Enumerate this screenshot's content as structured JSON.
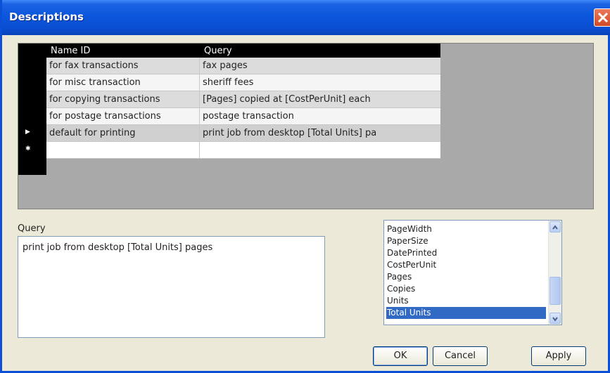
{
  "window": {
    "title": "Descriptions"
  },
  "grid": {
    "columns": [
      "Name ID",
      "Query"
    ],
    "rows": [
      {
        "name_id": "for fax transactions",
        "query": "fax pages"
      },
      {
        "name_id": "for misc transaction",
        "query": "sheriff fees"
      },
      {
        "name_id": "for copying transactions",
        "query": "[Pages] copied at [CostPerUnit] each"
      },
      {
        "name_id": "for postage transactions",
        "query": "postage transaction"
      },
      {
        "name_id": "default for printing",
        "query": "print job from desktop [Total Units] pa"
      }
    ],
    "current_row_marker": "▶",
    "new_row_marker": "✱"
  },
  "query": {
    "label": "Query",
    "value": "print job from desktop [Total Units] pages"
  },
  "fields_list": {
    "items": [
      "PageWidth",
      "PaperSize",
      "DatePrinted",
      "CostPerUnit",
      "Pages",
      "Copies",
      "Units",
      "Total Units"
    ],
    "selected": "Total Units"
  },
  "buttons": {
    "ok": "OK",
    "cancel": "Cancel",
    "apply": "Apply"
  }
}
